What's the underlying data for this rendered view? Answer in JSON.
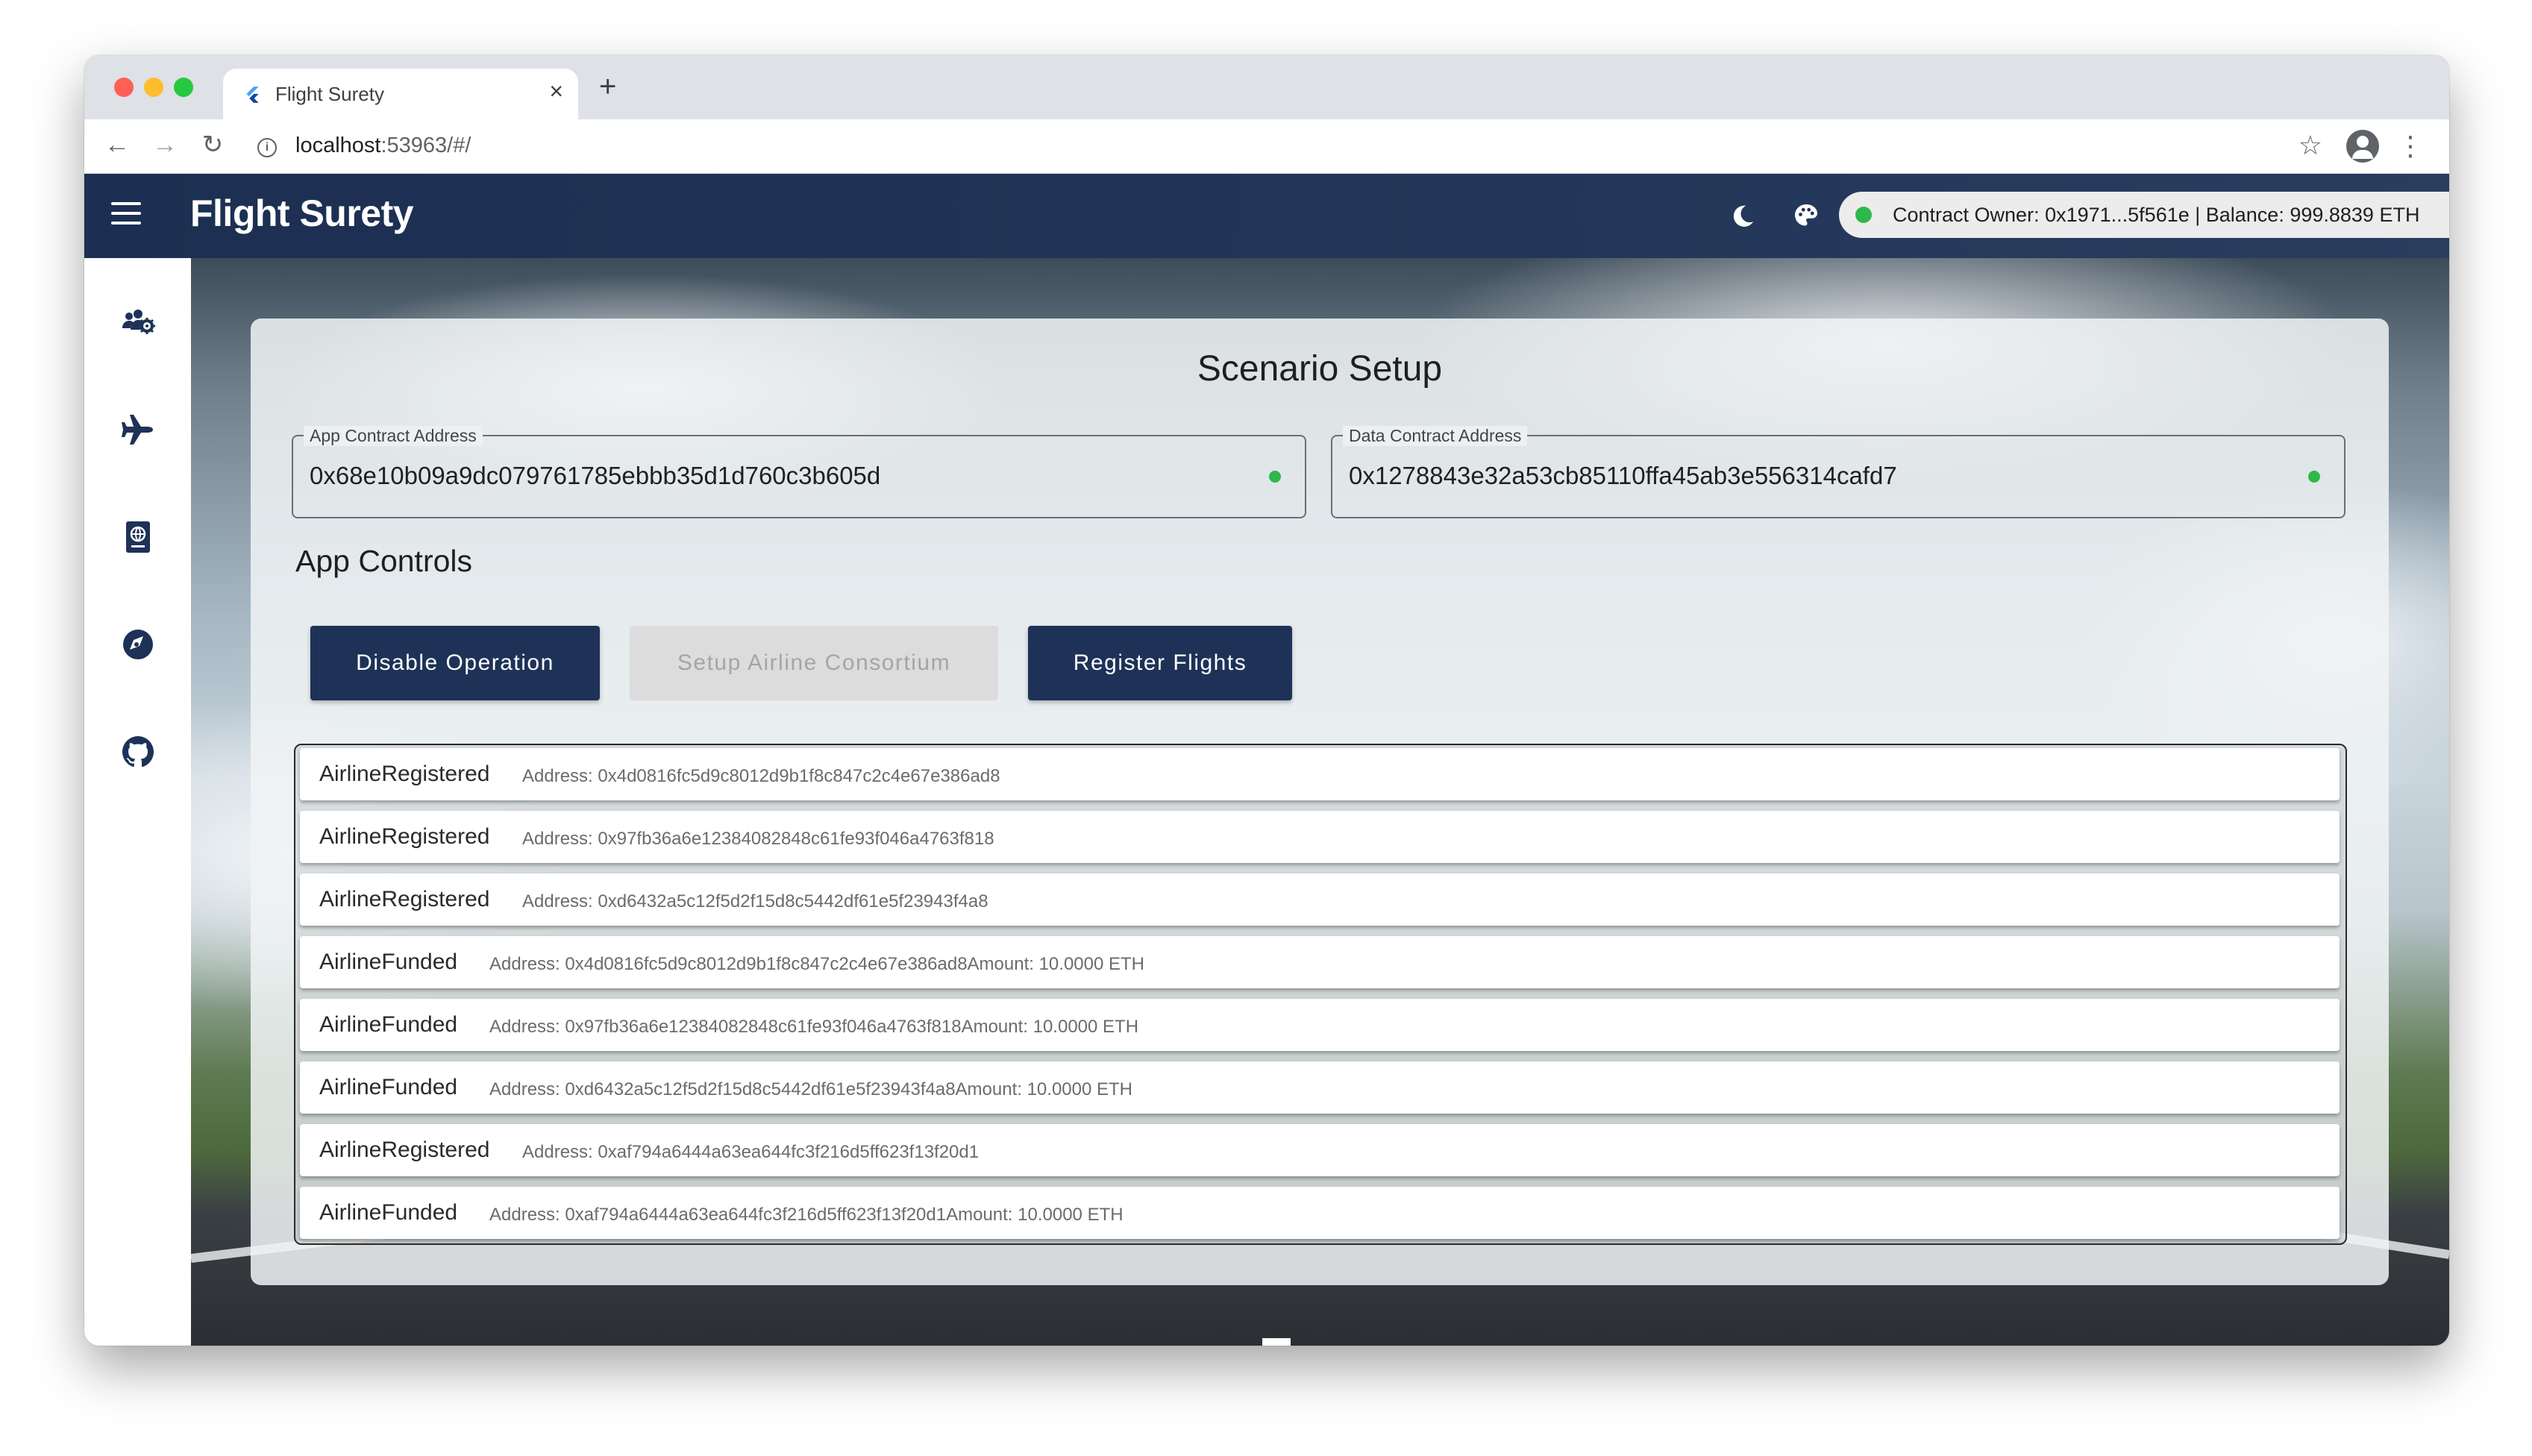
{
  "browser": {
    "tab_title": "Flight Surety",
    "tab_close": "×",
    "new_tab": "+",
    "url_host": "localhost",
    "url_rest": ":53963/#/",
    "back": "←",
    "forward": "→",
    "reload": "↻",
    "info": "i",
    "star": "☆",
    "menu": "⋮"
  },
  "app": {
    "title": "Flight Surety",
    "status": "Contract Owner: 0x1971...5f561e | Balance: 999.8839 ETH",
    "status_color": "#2eb84b",
    "appbar_color": "#1c2f52"
  },
  "sidebar": {
    "items": [
      {
        "icon": "users-cog-icon"
      },
      {
        "icon": "plane-icon"
      },
      {
        "icon": "passport-icon"
      },
      {
        "icon": "compass-icon"
      },
      {
        "icon": "github-icon"
      }
    ]
  },
  "scenario": {
    "title": "Scenario Setup",
    "app_contract_label": "App Contract Address",
    "app_contract_value": "0x68e10b09a9dc079761785ebbb35d1d760c3b605d",
    "data_contract_label": "Data Contract Address",
    "data_contract_value": "0x1278843e32a53cb85110ffa45ab3e556314cafd7",
    "controls_title": "App Controls",
    "buttons": {
      "disable": "Disable Operation",
      "setup": "Setup Airline Consortium",
      "register": "Register Flights"
    }
  },
  "events": [
    {
      "name": "AirlineRegistered",
      "detail": "Address: 0x4d0816fc5d9c8012d9b1f8c847c2c4e67e386ad8"
    },
    {
      "name": "AirlineRegistered",
      "detail": "Address: 0x97fb36a6e12384082848c61fe93f046a4763f818"
    },
    {
      "name": "AirlineRegistered",
      "detail": "Address: 0xd6432a5c12f5d2f15d8c5442df61e5f23943f4a8"
    },
    {
      "name": "AirlineFunded",
      "detail": "Address: 0x4d0816fc5d9c8012d9b1f8c847c2c4e67e386ad8Amount: 10.0000 ETH"
    },
    {
      "name": "AirlineFunded",
      "detail": "Address: 0x97fb36a6e12384082848c61fe93f046a4763f818Amount: 10.0000 ETH"
    },
    {
      "name": "AirlineFunded",
      "detail": "Address: 0xd6432a5c12f5d2f15d8c5442df61e5f23943f4a8Amount: 10.0000 ETH"
    },
    {
      "name": "AirlineRegistered",
      "detail": "Address: 0xaf794a6444a63ea644fc3f216d5ff623f13f20d1"
    },
    {
      "name": "AirlineFunded",
      "detail": "Address: 0xaf794a6444a63ea644fc3f216d5ff623f13f20d1Amount: 10.0000 ETH"
    }
  ]
}
